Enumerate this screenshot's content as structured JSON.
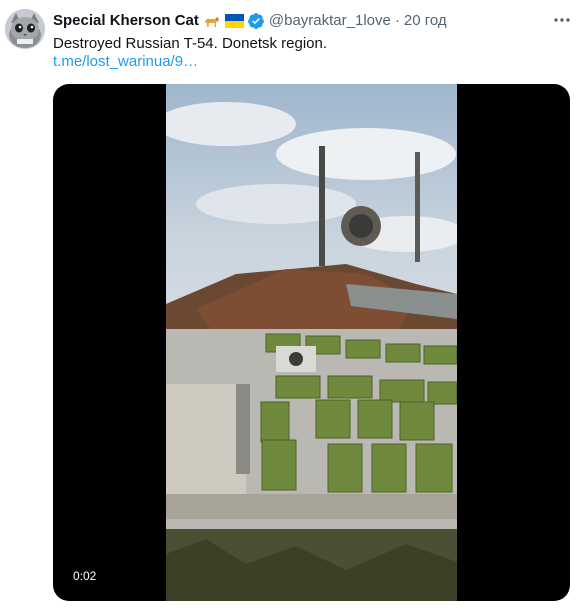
{
  "tweet": {
    "author_name": "Special Kherson Cat",
    "author_handle": "@bayraktar_1love",
    "separator": "·",
    "time": "20 год",
    "text": "Destroyed Russian T-54. Donetsk region.",
    "link": "t.me/lost_warinua/9…"
  },
  "icons": {
    "avatar": "cat-avatar",
    "emoji_1": "dog-icon",
    "emoji_2": "ukraine-flag-icon",
    "verified": "verified-badge-icon",
    "more": "more-icon"
  },
  "media": {
    "type": "video",
    "timestamp": "0:02"
  },
  "colors": {
    "link": "#1d9bf0",
    "verified": "#1d9bf0",
    "secondary_text": "#536471",
    "flag_blue": "#0057b7",
    "flag_yellow": "#ffd700"
  }
}
